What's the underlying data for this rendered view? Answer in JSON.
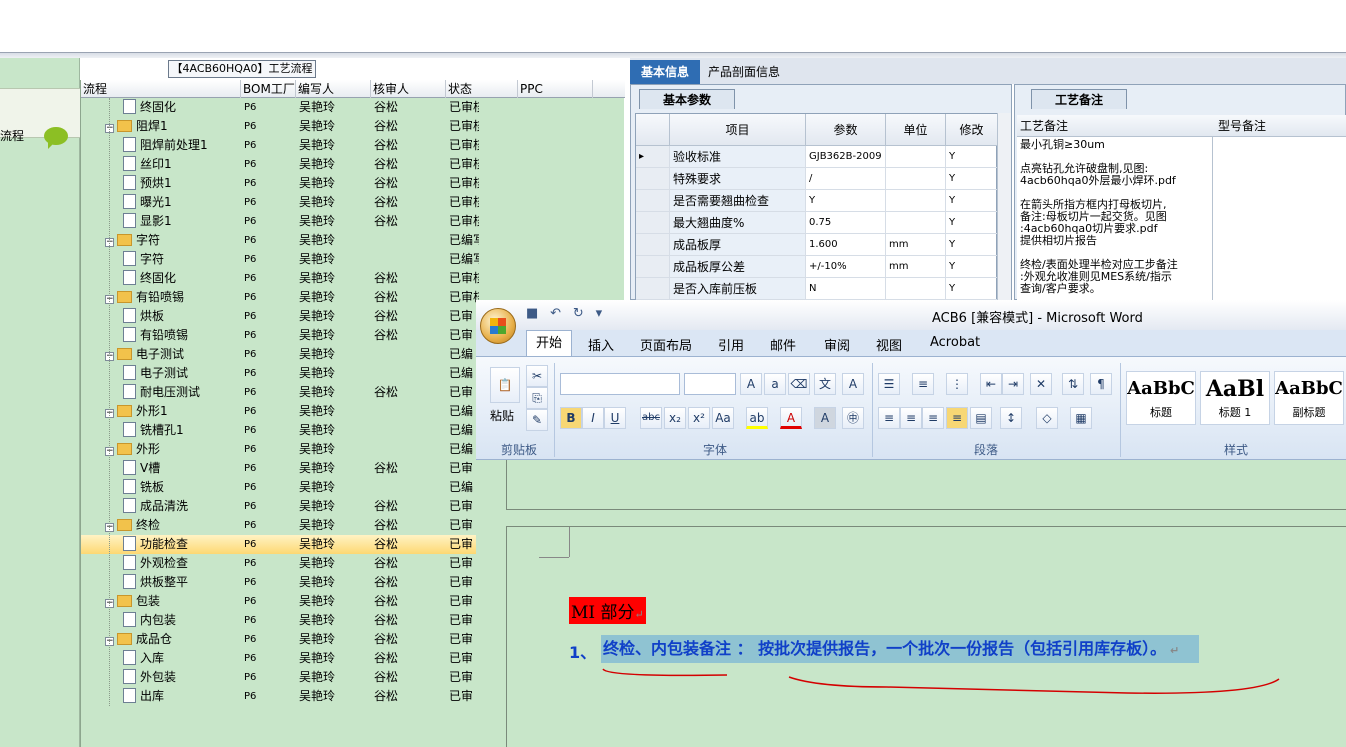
{
  "left_strip": {
    "label": "流程"
  },
  "tree": {
    "title": "【4ACB60HQA0】工艺流程",
    "columns": [
      "流程",
      "BOM工厂",
      "编写人",
      "核审人",
      "状态",
      "PPC"
    ],
    "rows": [
      {
        "name": "终固化",
        "level": 2,
        "folder": false,
        "bom": "P6",
        "editor": "吴艳玲",
        "reviewer": "谷松",
        "status": "已审核"
      },
      {
        "name": "阻焊1",
        "level": 1,
        "folder": true,
        "bom": "P6",
        "editor": "吴艳玲",
        "reviewer": "谷松",
        "status": "已审核"
      },
      {
        "name": "阻焊前处理1",
        "level": 2,
        "folder": false,
        "bom": "P6",
        "editor": "吴艳玲",
        "reviewer": "谷松",
        "status": "已审核"
      },
      {
        "name": "丝印1",
        "level": 2,
        "folder": false,
        "bom": "P6",
        "editor": "吴艳玲",
        "reviewer": "谷松",
        "status": "已审核"
      },
      {
        "name": "预烘1",
        "level": 2,
        "folder": false,
        "bom": "P6",
        "editor": "吴艳玲",
        "reviewer": "谷松",
        "status": "已审核"
      },
      {
        "name": "曝光1",
        "level": 2,
        "folder": false,
        "bom": "P6",
        "editor": "吴艳玲",
        "reviewer": "谷松",
        "status": "已审核"
      },
      {
        "name": "显影1",
        "level": 2,
        "folder": false,
        "bom": "P6",
        "editor": "吴艳玲",
        "reviewer": "谷松",
        "status": "已审核"
      },
      {
        "name": "字符",
        "level": 1,
        "folder": true,
        "bom": "P6",
        "editor": "吴艳玲",
        "reviewer": "",
        "status": "已编写"
      },
      {
        "name": "字符",
        "level": 2,
        "folder": false,
        "bom": "P6",
        "editor": "吴艳玲",
        "reviewer": "",
        "status": "已编写"
      },
      {
        "name": "终固化",
        "level": 2,
        "folder": false,
        "bom": "P6",
        "editor": "吴艳玲",
        "reviewer": "谷松",
        "status": "已审核"
      },
      {
        "name": "有铅喷锡",
        "level": 1,
        "folder": true,
        "bom": "P6",
        "editor": "吴艳玲",
        "reviewer": "谷松",
        "status": "已审核"
      },
      {
        "name": "烘板",
        "level": 2,
        "folder": false,
        "bom": "P6",
        "editor": "吴艳玲",
        "reviewer": "谷松",
        "status": "已审"
      },
      {
        "name": "有铅喷锡",
        "level": 2,
        "folder": false,
        "bom": "P6",
        "editor": "吴艳玲",
        "reviewer": "谷松",
        "status": "已审"
      },
      {
        "name": "电子测试",
        "level": 1,
        "folder": true,
        "bom": "P6",
        "editor": "吴艳玲",
        "reviewer": "",
        "status": "已编"
      },
      {
        "name": "电子测试",
        "level": 2,
        "folder": false,
        "bom": "P6",
        "editor": "吴艳玲",
        "reviewer": "",
        "status": "已编"
      },
      {
        "name": "耐电压测试",
        "level": 2,
        "folder": false,
        "bom": "P6",
        "editor": "吴艳玲",
        "reviewer": "谷松",
        "status": "已审"
      },
      {
        "name": "外形1",
        "level": 1,
        "folder": true,
        "bom": "P6",
        "editor": "吴艳玲",
        "reviewer": "",
        "status": "已编"
      },
      {
        "name": "铣槽孔1",
        "level": 2,
        "folder": false,
        "bom": "P6",
        "editor": "吴艳玲",
        "reviewer": "",
        "status": "已编"
      },
      {
        "name": "外形",
        "level": 1,
        "folder": true,
        "bom": "P6",
        "editor": "吴艳玲",
        "reviewer": "",
        "status": "已编"
      },
      {
        "name": "V槽",
        "level": 2,
        "folder": false,
        "bom": "P6",
        "editor": "吴艳玲",
        "reviewer": "谷松",
        "status": "已审"
      },
      {
        "name": "铣板",
        "level": 2,
        "folder": false,
        "bom": "P6",
        "editor": "吴艳玲",
        "reviewer": "",
        "status": "已编"
      },
      {
        "name": "成品清洗",
        "level": 2,
        "folder": false,
        "bom": "P6",
        "editor": "吴艳玲",
        "reviewer": "谷松",
        "status": "已审"
      },
      {
        "name": "终检",
        "level": 1,
        "folder": true,
        "bom": "P6",
        "editor": "吴艳玲",
        "reviewer": "谷松",
        "status": "已审"
      },
      {
        "name": "功能检查",
        "level": 2,
        "folder": false,
        "bom": "P6",
        "editor": "吴艳玲",
        "reviewer": "谷松",
        "status": "已审",
        "selected": true
      },
      {
        "name": "外观检查",
        "level": 2,
        "folder": false,
        "bom": "P6",
        "editor": "吴艳玲",
        "reviewer": "谷松",
        "status": "已审"
      },
      {
        "name": "烘板整平",
        "level": 2,
        "folder": false,
        "bom": "P6",
        "editor": "吴艳玲",
        "reviewer": "谷松",
        "status": "已审"
      },
      {
        "name": "包装",
        "level": 1,
        "folder": true,
        "bom": "P6",
        "editor": "吴艳玲",
        "reviewer": "谷松",
        "status": "已审"
      },
      {
        "name": "内包装",
        "level": 2,
        "folder": false,
        "bom": "P6",
        "editor": "吴艳玲",
        "reviewer": "谷松",
        "status": "已审"
      },
      {
        "name": "成品仓",
        "level": 1,
        "folder": true,
        "bom": "P6",
        "editor": "吴艳玲",
        "reviewer": "谷松",
        "status": "已审"
      },
      {
        "name": "入库",
        "level": 2,
        "folder": false,
        "bom": "P6",
        "editor": "吴艳玲",
        "reviewer": "谷松",
        "status": "已审"
      },
      {
        "name": "外包装",
        "level": 2,
        "folder": false,
        "bom": "P6",
        "editor": "吴艳玲",
        "reviewer": "谷松",
        "status": "已审"
      },
      {
        "name": "出库",
        "level": 2,
        "folder": false,
        "bom": "P6",
        "editor": "吴艳玲",
        "reviewer": "谷松",
        "status": "已审"
      }
    ]
  },
  "info": {
    "tabs": [
      "基本信息",
      "产品剖面信息"
    ],
    "params_tab": "基本参数",
    "params_columns": [
      "项目",
      "参数",
      "单位",
      "修改"
    ],
    "params": [
      {
        "name": "验收标准",
        "value": "GJB362B-2009",
        "unit": "",
        "mod": "Y",
        "current": true
      },
      {
        "name": "特殊要求",
        "value": "/",
        "unit": "",
        "mod": "Y"
      },
      {
        "name": "是否需要翘曲检查",
        "value": "Y",
        "unit": "",
        "mod": "Y"
      },
      {
        "name": "最大翘曲度%",
        "value": "0.75",
        "unit": "",
        "mod": "Y"
      },
      {
        "name": "成品板厚",
        "value": "1.600",
        "unit": "mm",
        "mod": "Y"
      },
      {
        "name": "成品板厚公差",
        "value": "+/-10%",
        "unit": "mm",
        "mod": "Y"
      },
      {
        "name": "是否入库前压板",
        "value": "N",
        "unit": "",
        "mod": "Y"
      }
    ],
    "notes_tab": "工艺备注",
    "notes_columns": [
      "工艺备注",
      "型号备注"
    ],
    "notes_text": "最小孔铜≥30um\n\n点亮钻孔允许破盘制,见图:\n4acb60hqa0外层最小焊环.pdf\n\n在箭头所指方框内打母板切片,\n备注:母板切片一起交货。见图\n:4acb60hqa0切片要求.pdf\n提供相切片报告\n\n终检/表面处理半检对应工步备注\n:外观允收准则见MES系统/指示\n查询/客户要求。"
  },
  "word": {
    "title": "ACB6 [兼容模式] - Microsoft Word",
    "ribbon_tabs": [
      "开始",
      "插入",
      "页面布局",
      "引用",
      "邮件",
      "审阅",
      "视图",
      "Acrobat"
    ],
    "groups": [
      "剪贴板",
      "字体",
      "段落",
      "样式"
    ],
    "paste_label": "粘贴",
    "styles": [
      {
        "sample": "AaBbC",
        "name": "标题"
      },
      {
        "sample": "AaBl",
        "name": "标题 1"
      },
      {
        "sample": "AaBbC",
        "name": "副标题"
      }
    ],
    "doc": {
      "heading": "MI 部分",
      "para_num": "1、",
      "para_text": "终检、内包装备注 ： 按批次提供报告，一个批次一份报告（包括引用库存板）。"
    }
  }
}
